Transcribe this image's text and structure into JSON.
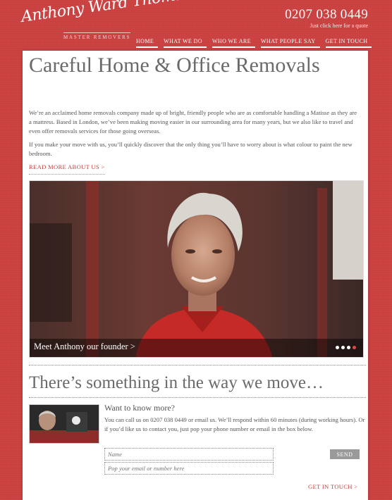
{
  "header": {
    "logo_text": "Anthony Ward Thomas",
    "logo_subtitle": "MASTER REMOVERS",
    "phone_number": "0207 038 0449",
    "phone_subtitle": "Just click here for a quote"
  },
  "nav": {
    "items": [
      "HOME",
      "WHAT WE DO",
      "WHO WE ARE",
      "WHAT PEOPLE SAY",
      "GET IN TOUCH"
    ]
  },
  "main": {
    "title": "Careful Home  & Office Removals",
    "intro_p1": "We’re an acclaimed home removals company made up of bright, friendly people who are as comfortable handling a Matisse as they are a mattress. Based in London, we’ve been making moving easier in our surrounding area for many years, but we also like to travel and even offer removals services for those going overseas.",
    "intro_p2": "If you make your move with us, you’ll quickly discover that the only thing you’ll have to worry about is what colour to paint the new bedroom.",
    "read_more": "READ MORE ABOUT US >"
  },
  "hero": {
    "caption": "Meet Anthony our founder  >",
    "slide_count": 4,
    "active_slide": 4
  },
  "contact": {
    "tagline": "There’s something in the way we move…",
    "heading": "Want to know more?",
    "text": "You can call us on 0207 038 0449 or email us. We’ll respond within 60 minutes (during working hours). Or if you’d like us to contact you, just pop your phone number or email in the box below.",
    "name_placeholder": "Name",
    "email_placeholder": "Pop your email or number here",
    "send_label": "SEND",
    "get_in_touch": "GET IN TOUCH >"
  },
  "colors": {
    "background": "#c9403f",
    "accent": "#c5403f",
    "panel": "#ffffff"
  }
}
